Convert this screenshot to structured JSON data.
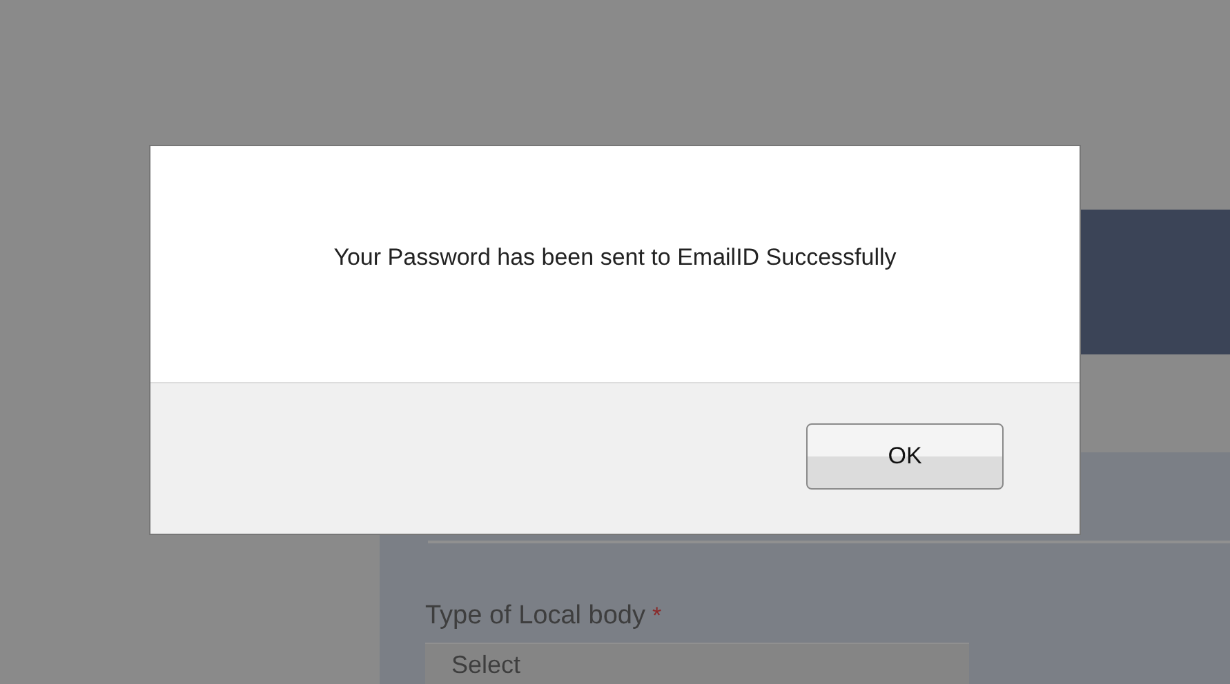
{
  "dialog": {
    "message": "Your Password has been sent to EmailID Successfully",
    "buttons": [
      "OK"
    ]
  },
  "form": {
    "fields": [
      {
        "label": "Type of Local body",
        "required_mark": "*",
        "value": "Select"
      }
    ]
  }
}
